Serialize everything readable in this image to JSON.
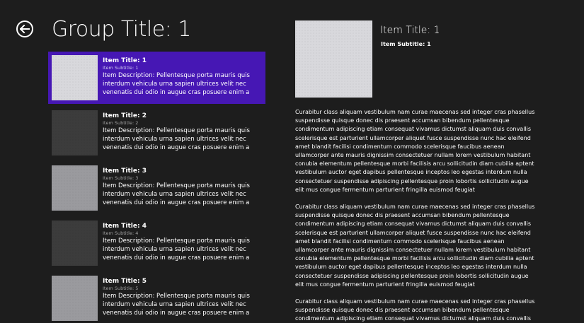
{
  "header": {
    "back_icon": "back-arrow-icon",
    "group_title": "Group Title: 1"
  },
  "items": [
    {
      "title": "Item Title: 1",
      "subtitle": "Item Subtitle: 1",
      "description": "Item Description: Pellentesque porta mauris quis interdum vehicula urna sapien ultrices velit nec venenatis dui odio in augue cras posuere enim a",
      "selected": true,
      "thumb_color": "#d8d8dc"
    },
    {
      "title": "Item Title: 2",
      "subtitle": "Item Subtitle: 2",
      "description": "Item Description: Pellentesque porta mauris quis interdum vehicula urna sapien ultrices velit nec venenatis dui odio in augue cras posuere enim a",
      "selected": false,
      "thumb_color": "#3c3c3c"
    },
    {
      "title": "Item Title: 3",
      "subtitle": "Item Subtitle: 3",
      "description": "Item Description: Pellentesque porta mauris quis interdum vehicula urna sapien ultrices velit nec venenatis dui odio in augue cras posuere enim a",
      "selected": false,
      "thumb_color": "#9a9a9e"
    },
    {
      "title": "Item Title: 4",
      "subtitle": "Item Subtitle: 4",
      "description": "Item Description: Pellentesque porta mauris quis interdum vehicula urna sapien ultrices velit nec venenatis dui odio in augue cras posuere enim a",
      "selected": false,
      "thumb_color": "#3c3c3c"
    },
    {
      "title": "Item Title: 5",
      "subtitle": "Item Subtitle: 5",
      "description": "Item Description: Pellentesque porta mauris quis interdum vehicula urna sapien ultrices velit nec venenatis dui odio in augue cras posuere enim a",
      "selected": false,
      "thumb_color": "#9a9a9e"
    }
  ],
  "detail": {
    "title": "Item Title: 1",
    "subtitle": "Item Subtitle: 1",
    "paragraphs": [
      "Curabitur class aliquam vestibulum nam curae maecenas sed integer cras phasellus suspendisse quisque donec dis praesent accumsan bibendum pellentesque condimentum adipiscing etiam consequat vivamus dictumst aliquam duis convallis scelerisque est parturient ullamcorper aliquet fusce suspendisse nunc hac eleifend amet blandit facilisi condimentum commodo scelerisque faucibus aenean ullamcorper ante mauris dignissim consectetuer nullam lorem vestibulum habitant conubia elementum pellentesque morbi facilisis arcu sollicitudin diam cubilia aptent vestibulum auctor eget dapibus pellentesque inceptos leo egestas interdum nulla consectetuer suspendisse adipiscing pellentesque proin lobortis sollicitudin augue elit mus congue fermentum parturient fringilla euismod feugiat",
      "Curabitur class aliquam vestibulum nam curae maecenas sed integer cras phasellus suspendisse quisque donec dis praesent accumsan bibendum pellentesque condimentum adipiscing etiam consequat vivamus dictumst aliquam duis convallis scelerisque est parturient ullamcorper aliquet fusce suspendisse nunc hac eleifend amet blandit facilisi condimentum commodo scelerisque faucibus aenean ullamcorper ante mauris dignissim consectetuer nullam lorem vestibulum habitant conubia elementum pellentesque morbi facilisis arcu sollicitudin diam cubilia aptent vestibulum auctor eget dapibus pellentesque inceptos leo egestas interdum nulla consectetuer suspendisse adipiscing pellentesque proin lobortis sollicitudin augue elit mus congue fermentum parturient fringilla euismod feugiat",
      "Curabitur class aliquam vestibulum nam curae maecenas sed integer cras phasellus suspendisse quisque donec dis praesent accumsan bibendum pellentesque condimentum adipiscing etiam consequat vivamus dictumst aliquam duis convallis scelerisque est parturient ullamcorper aliquet fusce suspendisse nunc hac eleifend"
    ]
  },
  "colors": {
    "background": "#1d1d1d",
    "accent_selected": "#4617b4",
    "text": "#ffffff",
    "subtitle_text": "#a0a0a0"
  }
}
